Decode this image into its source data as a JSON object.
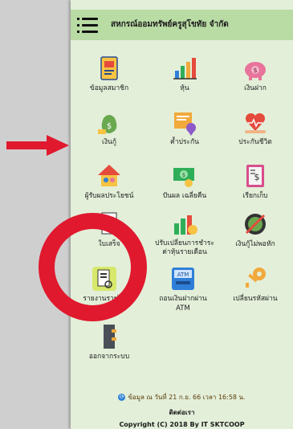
{
  "header": {
    "title": "สหกรณ์ออมทรัพย์ครูสุโขทัย จำกัด"
  },
  "menu": [
    {
      "label": "ข้อมูลสมาชิก",
      "icon": "member-card-icon"
    },
    {
      "label": "หุ้น",
      "icon": "share-chart-icon"
    },
    {
      "label": "เงินฝาก",
      "icon": "piggy-bank-icon"
    },
    {
      "label": "เงินกู้",
      "icon": "money-bag-icon"
    },
    {
      "label": "ค้ำประกัน",
      "icon": "guarantee-certificate-icon"
    },
    {
      "label": "ประกันชีวิต",
      "icon": "life-insurance-icon"
    },
    {
      "label": "ผู้รับผลประโยชน์",
      "icon": "beneficiary-house-icon"
    },
    {
      "label": "ปันผล เฉลี่ยคืน",
      "icon": "dividend-money-icon"
    },
    {
      "label": "เรียกเก็บ",
      "icon": "billing-receipt-icon"
    },
    {
      "label": "ใบเสร็จ",
      "icon": "receipt-icon"
    },
    {
      "label_lines": [
        "ปรับเปลี่ยนการชำระ",
        "ค่าหุ้นรายเดือน"
      ],
      "icon": "change-payment-icon"
    },
    {
      "label": "เงินกู้ไม่พอหัก",
      "icon": "loan-insufficient-icon"
    },
    {
      "label": "รายงานรายได้",
      "icon": "report-income-icon"
    },
    {
      "label_lines": [
        "ถอนเงินฝากผ่าน",
        "ATM"
      ],
      "icon": "atm-icon"
    },
    {
      "label": "เปลี่ยนรหัสผ่าน",
      "icon": "change-password-key-icon"
    },
    {
      "label": "ออกจากระบบ",
      "icon": "logout-door-icon"
    }
  ],
  "footer": {
    "updated": "ข้อมูล ณ วันที่ 21 ก.ย. 66 เวลา 16:58 น.",
    "contact": "ติดต่อเรา",
    "copyright": "Copyright (C) 2018 By IT SKTCOOP"
  },
  "colors": {
    "header_bg": "#b9dba4",
    "content_bg": "#e3efd9",
    "annotation_red": "#e0192e"
  }
}
